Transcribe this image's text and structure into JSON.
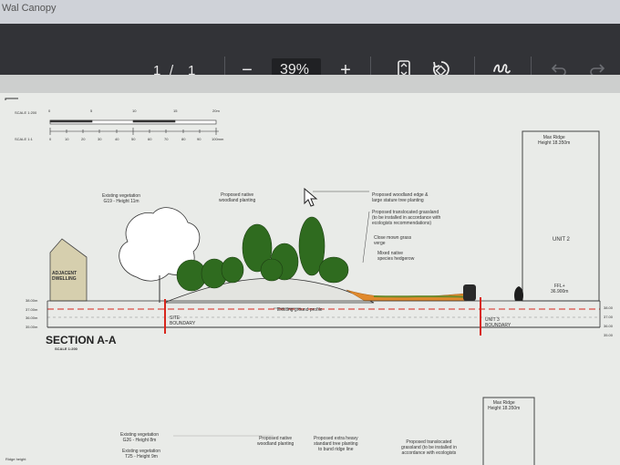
{
  "browser": {
    "tab_title": "Wal Canopy"
  },
  "toolbar": {
    "page_current": "1",
    "page_sep": "/",
    "page_total": "1",
    "zoom_out_symbol": "−",
    "zoom_level": "39%",
    "zoom_in_symbol": "+",
    "icons": [
      "fit-page-icon",
      "rotate-icon",
      "draw-icon",
      "undo-icon",
      "redo-icon"
    ]
  },
  "drawing": {
    "scale_small": "SCALE 1:200",
    "scale_large": "SCALE 1:1",
    "scale_top_ticks": [
      "0",
      "5",
      "10",
      "15",
      "20m"
    ],
    "scale_bottom_ticks": [
      "0",
      "10",
      "20",
      "30",
      "40",
      "50",
      "60",
      "70",
      "80",
      "90",
      "100mm"
    ],
    "labels": {
      "existing_veg_top": "Existing vegetation\nG19 - Height 11m",
      "proposed_native_top": "Proposed native\nwoodland planting",
      "woodland_edge": "Proposed woodland edge &\nlarge stature tree planting",
      "translocated_top": "Proposed translocated grassland\n(to be installed in accordance with\necologists recommendations)",
      "close_mown": "Close mown grass\nverge",
      "mixed_native": "Mixed native\nspecies hedgerow",
      "max_ridge_top": "Max Ridge\nHeight 18.350m",
      "unit2": "UNIT 2",
      "ffl": "FFL+\n36.900m",
      "adjacent_dwelling": "ADJACENT\nDWELLING",
      "existing_ground": "Existing ground profile",
      "site_boundary": "SITE\nBOUNDARY",
      "unit3_boundary": "UNIT 3\nBOUNDARY",
      "section_title": "SECTION A-A",
      "section_scale": "SCALE 1:200",
      "levels_left": [
        "38.00m",
        "37.00m",
        "36.00m",
        "35.00m"
      ],
      "levels_right": [
        "38.00",
        "37.00",
        "36.00",
        "35.00"
      ],
      "existing_veg_g26": "Existing vegetation\nG26 - Height 8m",
      "existing_veg_t25": "Existing vegetation\nT25 - Height 9m",
      "proposed_native_bottom": "Proposed native\nwoodland planting",
      "extra_heavy": "Proposed extra heavy\nstandard tree planting\nto bund ridge line",
      "translocated_bottom": "Proposed translocated\ngrassland (to be installed in\naccordance with ecologists",
      "max_ridge_bottom": "Max Ridge\nHeight 18.350m",
      "ridge_height": "Ridge height"
    }
  },
  "colors": {
    "toolbar": "#323337",
    "sheet": "#e9ebe8",
    "boundary_red": "#d8261c",
    "tree_green": "#2f6b1f",
    "hedge_orange": "#e0892c"
  }
}
